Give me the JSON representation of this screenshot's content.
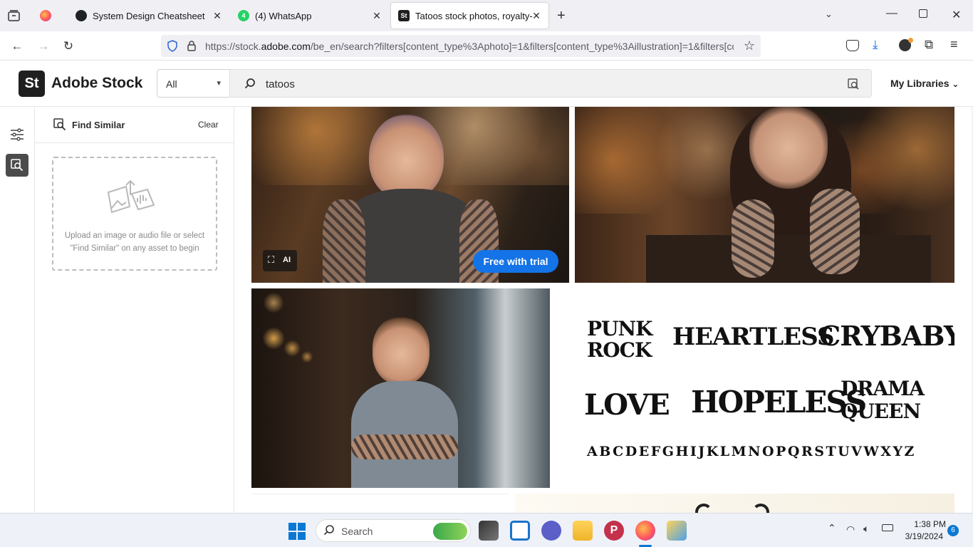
{
  "browser": {
    "tabs": [
      {
        "title": "",
        "favicon": "firefox-icon"
      },
      {
        "title": "System Design Cheatsheet",
        "favicon": "github-icon"
      },
      {
        "title": "(4) WhatsApp",
        "favicon": "whatsapp-icon"
      },
      {
        "title": "Tatoos stock photos, royalty-free",
        "favicon": "adobe-stock-icon",
        "active": true
      }
    ],
    "url": {
      "prefix": "https://stock.",
      "domain": "adobe.com",
      "rest": "/be_en/search?filters[content_type%3Aphoto]=1&filters[content_type%3Aillustration]=1&filters[co"
    }
  },
  "header": {
    "logo_text": "St",
    "brand": "Adobe Stock",
    "scope_value": "All",
    "search_query": "tatoos",
    "my_libraries": "My Libraries"
  },
  "find_similar": {
    "title": "Find Similar",
    "clear": "Clear",
    "drop_line1": "Upload an image or audio file or select",
    "drop_line2": "\"Find Similar\" on any asset to begin"
  },
  "results": {
    "ai_badge": "AI",
    "trial_button": "Free with trial",
    "font_art": {
      "w1": "PUNK ROCK",
      "w2": "HEARTLESS",
      "w3": "CRYBABY",
      "w4": "LOVE",
      "w5": "HOPELESS",
      "w6": "DRAMA QUEEN",
      "alphabet": "ABCDEFGHIJKLMNOPQRSTUVWXYZ"
    }
  },
  "taskbar": {
    "search_placeholder": "Search",
    "time": "1:38 PM",
    "date": "3/19/2024",
    "notifications": "6"
  },
  "colors": {
    "accent": "#1473e6",
    "dark": "#1f1f1f"
  }
}
